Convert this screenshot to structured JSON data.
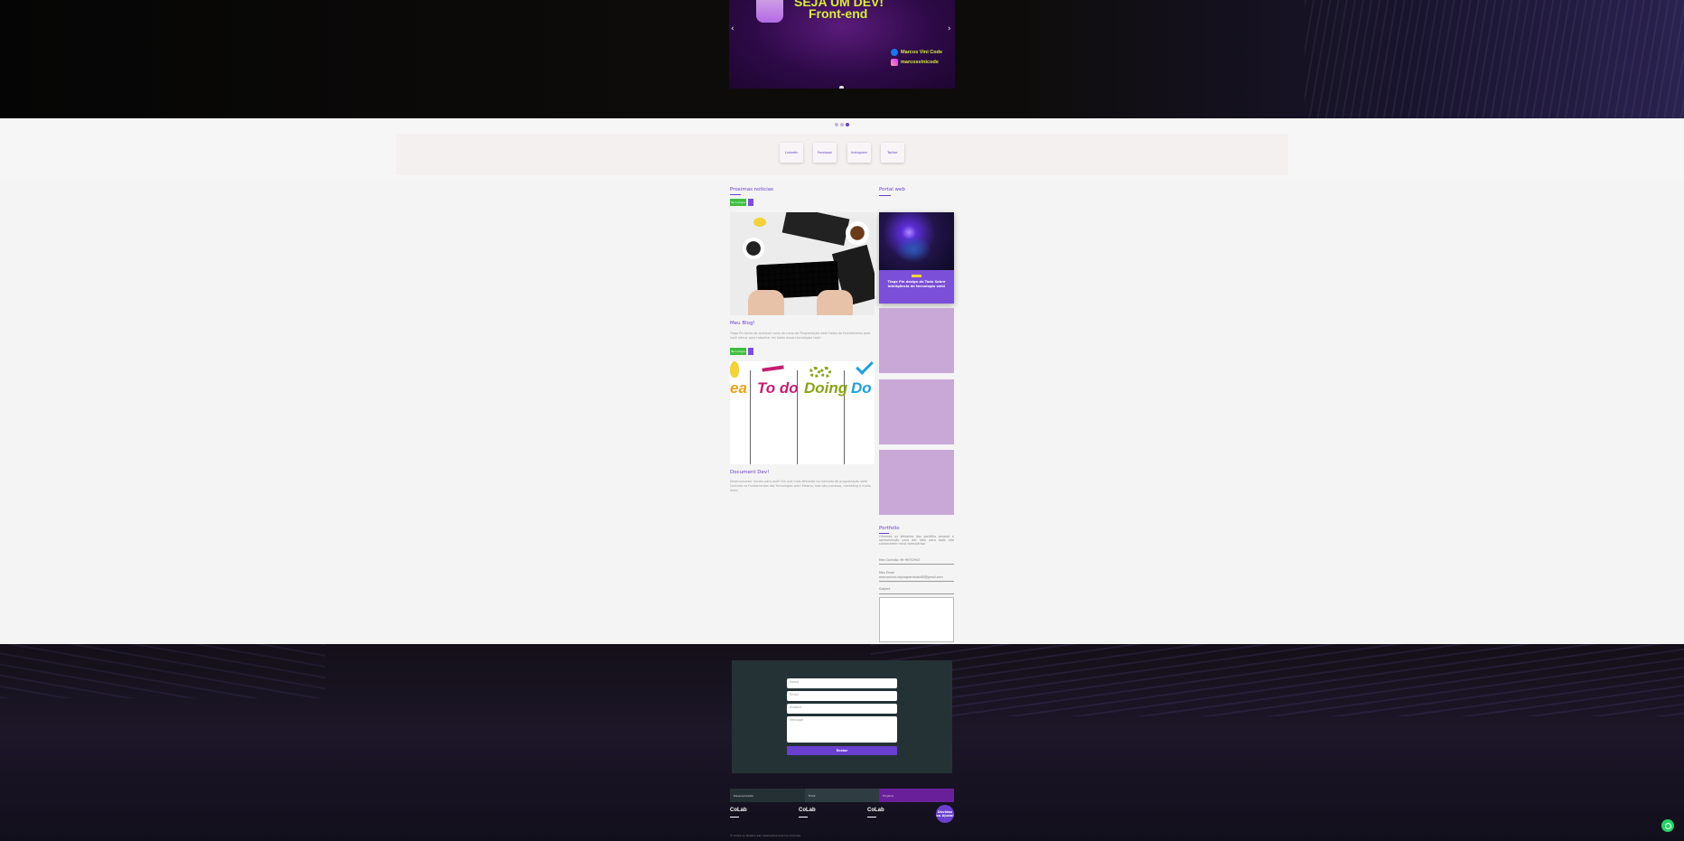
{
  "hero": {
    "slide_line1": "SEJA UM DEV!",
    "slide_line2": "Front-end",
    "social_facebook": "Marcos Vini Code",
    "social_instagram": "marcosvinicode",
    "prev_icon": "‹",
    "next_icon": "›"
  },
  "social_bar": {
    "buttons": [
      "LinkedIn",
      "Facebook",
      "Instagram",
      "Twitter"
    ]
  },
  "news": {
    "title": "Proximas noticias",
    "items": [
      {
        "tag": "Tecnologia",
        "title": "Meu Blog!",
        "desc": "Tiago Pin Antes de qualquer coisa do curso de Programação web! Desta de Entretimento para você alterar para trabalhar em todas essas tecnologias hoje!"
      },
      {
        "tag": "Tecnologia",
        "title": "Document Dev!",
        "desc": "Desenvolvedor Iniciais para você! Em que mais diferente no mercado de programação web! Contrate os Fundamentos das Tecnologias web! Mesmo, mas são processo, marketing e muito mais!"
      }
    ],
    "img2_labels": [
      "ea",
      "To do",
      "Doing",
      "Do"
    ]
  },
  "portal": {
    "title": "Portal web",
    "first_card_text": "Tiago Pin design do Tudo Sobre Inteligência de tecnologia web!"
  },
  "portfolio": {
    "title": "Portfolio",
    "desc": "Olhemos os Websites dos portfólio pessoal e apresentação para dar likes para após não conhecerem meus formulários!",
    "field_phone": "Meu Contato: 99 99752943",
    "field_email_label": "Meu Email",
    "field_email_value": "marcosvinicuisprogramador00@gmail.com",
    "field_subject": "Subject"
  },
  "footer": {
    "input_name": "Name",
    "input_email": "Email",
    "input_subject": "Subject",
    "input_message": "Message",
    "submit_label": "Enviar",
    "bars": [
      "Desenvolvedor",
      "Front",
      "Projetos"
    ],
    "brands": [
      "CoLab",
      "CoLab",
      "CoLab"
    ],
    "help_label": "Dúvidas ou Ajuda!",
    "copyright": "© todos os direitos são reservados marcos vinicode"
  },
  "colors": {
    "accent": "#6a3fd0",
    "tag_green": "#3fbf3f",
    "card_lilac": "#c9a8d8",
    "whatsapp": "#25d366"
  },
  "icons": [
    "chevron-left-icon",
    "chevron-right-icon",
    "facebook-icon",
    "instagram-icon",
    "whatsapp-icon"
  ]
}
